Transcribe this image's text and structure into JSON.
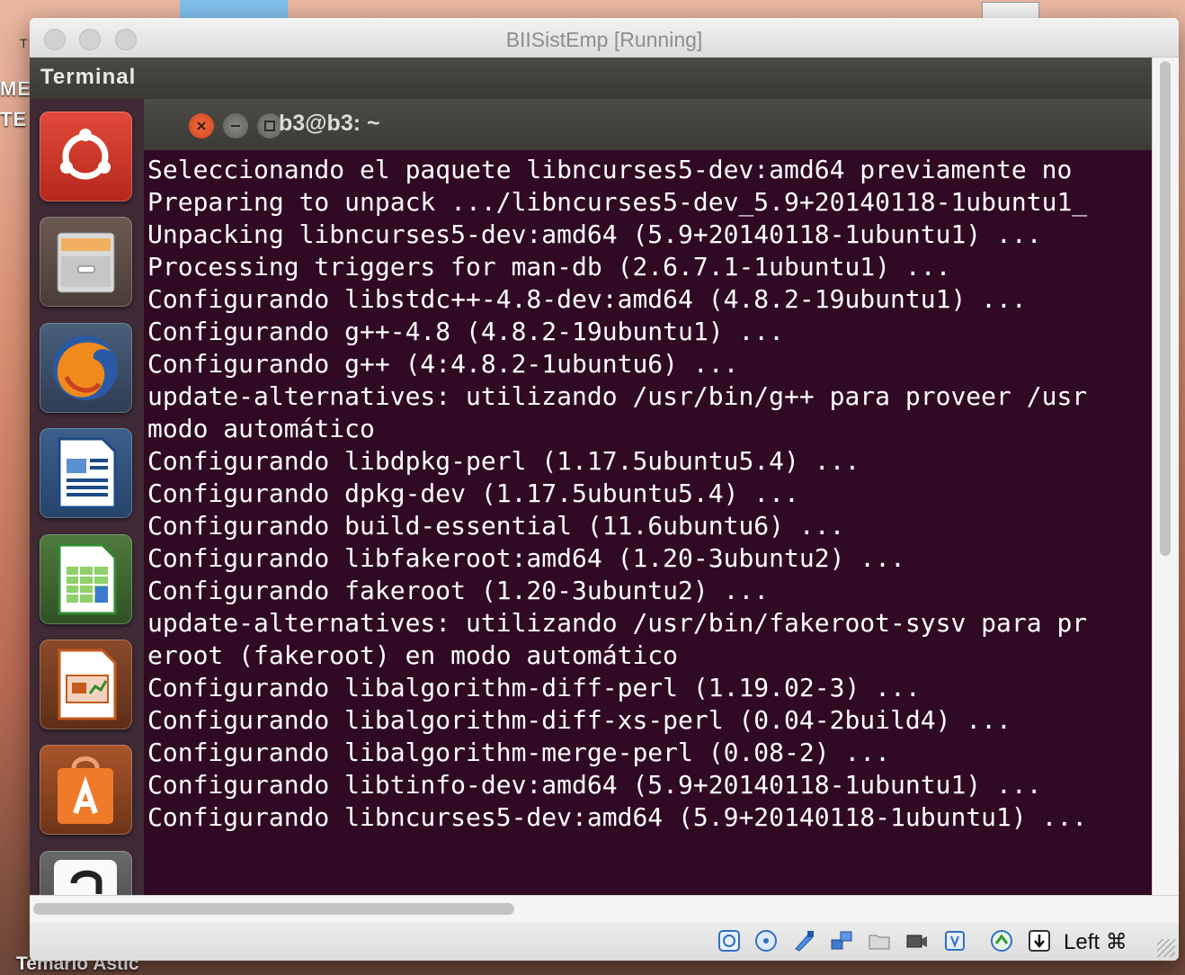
{
  "desktop": {
    "left_label_1": "ME",
    "left_label_2": "TE",
    "corner_letter": "T",
    "bottom_label": "Temario Astic"
  },
  "window": {
    "title": "BIISistEmp [Running]"
  },
  "unity": {
    "panel_title": "Terminal",
    "launcher_icons": [
      "ubuntu-dash-icon",
      "files-icon",
      "firefox-icon",
      "writer-icon",
      "calc-icon",
      "impress-icon",
      "software-center-icon",
      "amazon-icon"
    ]
  },
  "terminal": {
    "title": "b3@b3: ~",
    "lines": [
      "Seleccionando el paquete libncurses5-dev:amd64 previamente no",
      "Preparing to unpack .../libncurses5-dev_5.9+20140118-1ubuntu1_",
      "Unpacking libncurses5-dev:amd64 (5.9+20140118-1ubuntu1) ...",
      "Processing triggers for man-db (2.6.7.1-1ubuntu1) ...",
      "Configurando libstdc++-4.8-dev:amd64 (4.8.2-19ubuntu1) ...",
      "Configurando g++-4.8 (4.8.2-19ubuntu1) ...",
      "Configurando g++ (4:4.8.2-1ubuntu6) ...",
      "update-alternatives: utilizando /usr/bin/g++ para proveer /usr",
      "modo automático",
      "Configurando libdpkg-perl (1.17.5ubuntu5.4) ...",
      "Configurando dpkg-dev (1.17.5ubuntu5.4) ...",
      "Configurando build-essential (11.6ubuntu6) ...",
      "Configurando libfakeroot:amd64 (1.20-3ubuntu2) ...",
      "Configurando fakeroot (1.20-3ubuntu2) ...",
      "update-alternatives: utilizando /usr/bin/fakeroot-sysv para pr",
      "eroot (fakeroot) en modo automático",
      "Configurando libalgorithm-diff-perl (1.19.02-3) ...",
      "Configurando libalgorithm-diff-xs-perl (0.04-2build4) ...",
      "Configurando libalgorithm-merge-perl (0.08-2) ...",
      "Configurando libtinfo-dev:amd64 (5.9+20140118-1ubuntu1) ...",
      "Configurando libncurses5-dev:amd64 (5.9+20140118-1ubuntu1) ..."
    ]
  },
  "statusbar": {
    "icons": [
      "hard-disk-icon",
      "optical-disc-icon",
      "usb-icon",
      "network-icon",
      "shared-folder-icon",
      "video-capture-icon",
      "cpu-icon",
      "mouse-integration-icon",
      "keyboard-capture-icon"
    ],
    "host_key": "Left ⌘"
  }
}
